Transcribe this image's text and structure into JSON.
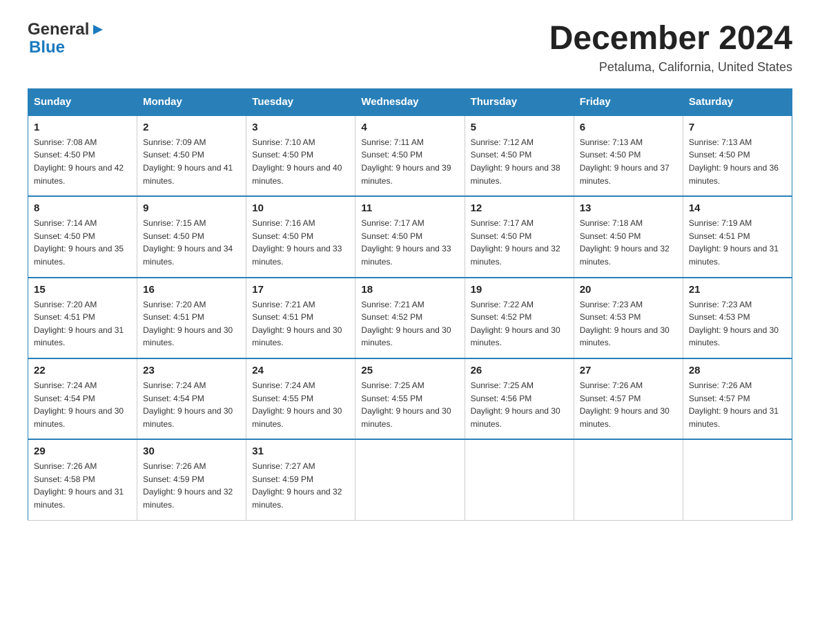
{
  "logo": {
    "general": "General",
    "arrow": "▶",
    "blue": "Blue"
  },
  "header": {
    "month": "December 2024",
    "location": "Petaluma, California, United States"
  },
  "days_of_week": [
    "Sunday",
    "Monday",
    "Tuesday",
    "Wednesday",
    "Thursday",
    "Friday",
    "Saturday"
  ],
  "weeks": [
    [
      {
        "day": "1",
        "sunrise": "7:08 AM",
        "sunset": "4:50 PM",
        "daylight": "9 hours and 42 minutes."
      },
      {
        "day": "2",
        "sunrise": "7:09 AM",
        "sunset": "4:50 PM",
        "daylight": "9 hours and 41 minutes."
      },
      {
        "day": "3",
        "sunrise": "7:10 AM",
        "sunset": "4:50 PM",
        "daylight": "9 hours and 40 minutes."
      },
      {
        "day": "4",
        "sunrise": "7:11 AM",
        "sunset": "4:50 PM",
        "daylight": "9 hours and 39 minutes."
      },
      {
        "day": "5",
        "sunrise": "7:12 AM",
        "sunset": "4:50 PM",
        "daylight": "9 hours and 38 minutes."
      },
      {
        "day": "6",
        "sunrise": "7:13 AM",
        "sunset": "4:50 PM",
        "daylight": "9 hours and 37 minutes."
      },
      {
        "day": "7",
        "sunrise": "7:13 AM",
        "sunset": "4:50 PM",
        "daylight": "9 hours and 36 minutes."
      }
    ],
    [
      {
        "day": "8",
        "sunrise": "7:14 AM",
        "sunset": "4:50 PM",
        "daylight": "9 hours and 35 minutes."
      },
      {
        "day": "9",
        "sunrise": "7:15 AM",
        "sunset": "4:50 PM",
        "daylight": "9 hours and 34 minutes."
      },
      {
        "day": "10",
        "sunrise": "7:16 AM",
        "sunset": "4:50 PM",
        "daylight": "9 hours and 33 minutes."
      },
      {
        "day": "11",
        "sunrise": "7:17 AM",
        "sunset": "4:50 PM",
        "daylight": "9 hours and 33 minutes."
      },
      {
        "day": "12",
        "sunrise": "7:17 AM",
        "sunset": "4:50 PM",
        "daylight": "9 hours and 32 minutes."
      },
      {
        "day": "13",
        "sunrise": "7:18 AM",
        "sunset": "4:50 PM",
        "daylight": "9 hours and 32 minutes."
      },
      {
        "day": "14",
        "sunrise": "7:19 AM",
        "sunset": "4:51 PM",
        "daylight": "9 hours and 31 minutes."
      }
    ],
    [
      {
        "day": "15",
        "sunrise": "7:20 AM",
        "sunset": "4:51 PM",
        "daylight": "9 hours and 31 minutes."
      },
      {
        "day": "16",
        "sunrise": "7:20 AM",
        "sunset": "4:51 PM",
        "daylight": "9 hours and 30 minutes."
      },
      {
        "day": "17",
        "sunrise": "7:21 AM",
        "sunset": "4:51 PM",
        "daylight": "9 hours and 30 minutes."
      },
      {
        "day": "18",
        "sunrise": "7:21 AM",
        "sunset": "4:52 PM",
        "daylight": "9 hours and 30 minutes."
      },
      {
        "day": "19",
        "sunrise": "7:22 AM",
        "sunset": "4:52 PM",
        "daylight": "9 hours and 30 minutes."
      },
      {
        "day": "20",
        "sunrise": "7:23 AM",
        "sunset": "4:53 PM",
        "daylight": "9 hours and 30 minutes."
      },
      {
        "day": "21",
        "sunrise": "7:23 AM",
        "sunset": "4:53 PM",
        "daylight": "9 hours and 30 minutes."
      }
    ],
    [
      {
        "day": "22",
        "sunrise": "7:24 AM",
        "sunset": "4:54 PM",
        "daylight": "9 hours and 30 minutes."
      },
      {
        "day": "23",
        "sunrise": "7:24 AM",
        "sunset": "4:54 PM",
        "daylight": "9 hours and 30 minutes."
      },
      {
        "day": "24",
        "sunrise": "7:24 AM",
        "sunset": "4:55 PM",
        "daylight": "9 hours and 30 minutes."
      },
      {
        "day": "25",
        "sunrise": "7:25 AM",
        "sunset": "4:55 PM",
        "daylight": "9 hours and 30 minutes."
      },
      {
        "day": "26",
        "sunrise": "7:25 AM",
        "sunset": "4:56 PM",
        "daylight": "9 hours and 30 minutes."
      },
      {
        "day": "27",
        "sunrise": "7:26 AM",
        "sunset": "4:57 PM",
        "daylight": "9 hours and 30 minutes."
      },
      {
        "day": "28",
        "sunrise": "7:26 AM",
        "sunset": "4:57 PM",
        "daylight": "9 hours and 31 minutes."
      }
    ],
    [
      {
        "day": "29",
        "sunrise": "7:26 AM",
        "sunset": "4:58 PM",
        "daylight": "9 hours and 31 minutes."
      },
      {
        "day": "30",
        "sunrise": "7:26 AM",
        "sunset": "4:59 PM",
        "daylight": "9 hours and 32 minutes."
      },
      {
        "day": "31",
        "sunrise": "7:27 AM",
        "sunset": "4:59 PM",
        "daylight": "9 hours and 32 minutes."
      },
      null,
      null,
      null,
      null
    ]
  ]
}
